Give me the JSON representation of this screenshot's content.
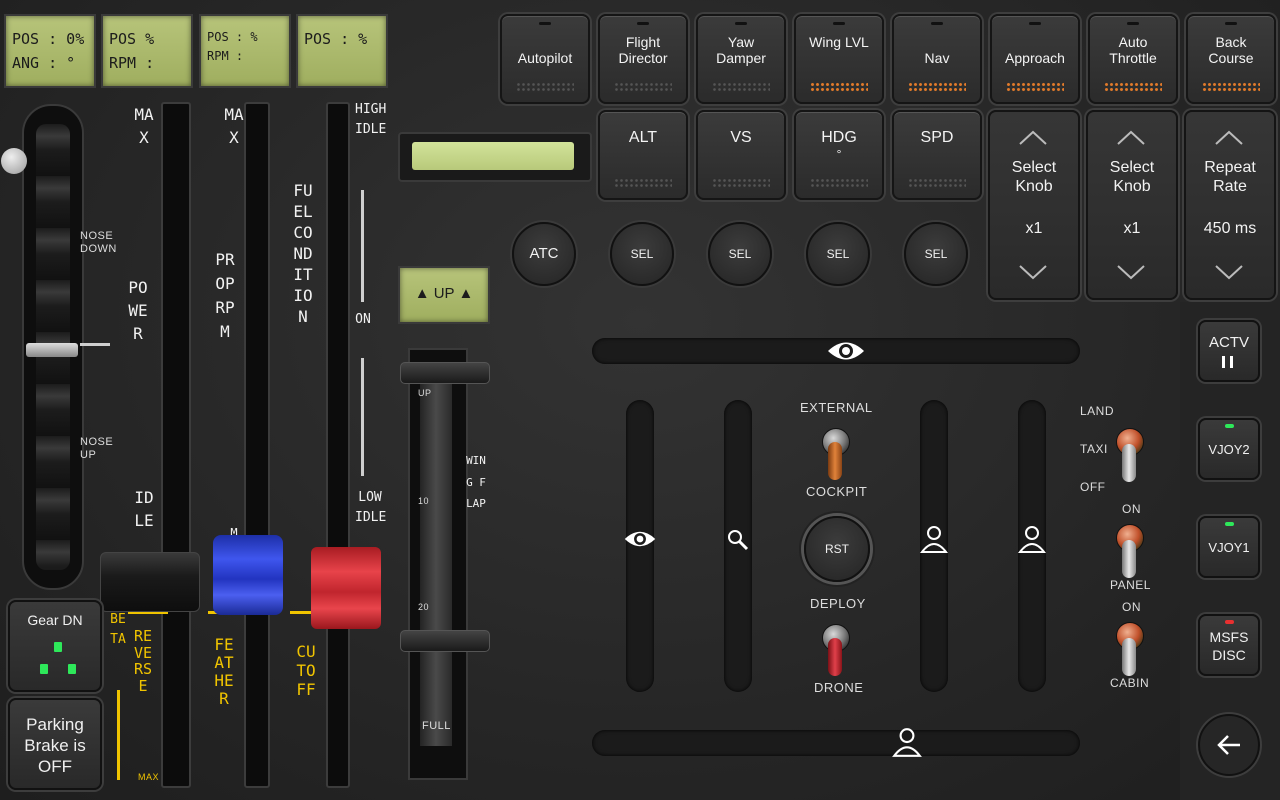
{
  "lcds": [
    {
      "line1": "POS : 0%",
      "line2": "ANG : °"
    },
    {
      "line1": "POS     %",
      "line2": "RPM :"
    },
    {
      "line1": "POS : %",
      "line2": "RPM :"
    },
    {
      "line1": "POS : %",
      "line2": ""
    }
  ],
  "elevator_trim": {
    "nose_down": "NOSE DOWN",
    "nose_up": "NOSE UP"
  },
  "power": {
    "max": "MAX",
    "label": "POWER",
    "idle": "IDLE",
    "beta": "BETA",
    "reverse": "REVERSE",
    "reverse_max": "MAX"
  },
  "prop": {
    "max": "MAX",
    "label": "PROP RPM",
    "min": "M",
    "feather": "FEATHER"
  },
  "fuel": {
    "high_idle": "HIGH IDLE",
    "label": "FUEL CONDITION",
    "on": "ON",
    "low_idle": "LOW IDLE",
    "cutoff": "CUTOFF"
  },
  "flaps": {
    "indicator": "▲ UP ▲",
    "up": "UP",
    "ten": "10",
    "twenty": "20",
    "full": "FULL",
    "label": "WING FLAP",
    "deg": "°"
  },
  "gear": {
    "label": "Gear DN"
  },
  "parking_brake": {
    "label": "Parking Brake is OFF"
  },
  "autopilot_row1": [
    {
      "label": "Autopilot"
    },
    {
      "label": "Flight Director"
    },
    {
      "label": "Yaw Damper"
    },
    {
      "label": "Wing LVL"
    },
    {
      "label": "Nav"
    },
    {
      "label": "Approach"
    },
    {
      "label": "Auto Throttle"
    },
    {
      "label": "Back Course"
    }
  ],
  "autopilot_row2": [
    {
      "label": "ALT",
      "sub": ""
    },
    {
      "label": "VS",
      "sub": ""
    },
    {
      "label": "HDG",
      "sub": "°"
    },
    {
      "label": "SPD",
      "sub": ""
    }
  ],
  "round_buttons": {
    "atc": "ATC",
    "sel": "SEL",
    "rst": "RST"
  },
  "knobs": [
    {
      "label": "Select Knob",
      "value": "x1"
    },
    {
      "label": "Select Knob",
      "value": "x1"
    },
    {
      "label": "Repeat Rate",
      "value": "450 ms"
    }
  ],
  "camera": {
    "external": "EXTERNAL",
    "cockpit": "COCKPIT",
    "deploy": "DEPLOY",
    "drone": "DRONE"
  },
  "lights": {
    "land": "LAND",
    "taxi": "TAXI",
    "off": "OFF",
    "on1": "ON",
    "panel": "PANEL",
    "on2": "ON",
    "cabin": "CABIN"
  },
  "side": {
    "actv": "ACTV",
    "vjoy2": "VJOY2",
    "vjoy1": "VJOY1",
    "msfs": "MSFS DISC"
  },
  "colors": {
    "led_green": "#2ee85a",
    "led_red": "#e83030",
    "caption_yellow": "#f0c400",
    "power_lever": "#1e1e1e",
    "prop_lever": "#2b3fd0",
    "fuel_lever": "#d42c34"
  }
}
